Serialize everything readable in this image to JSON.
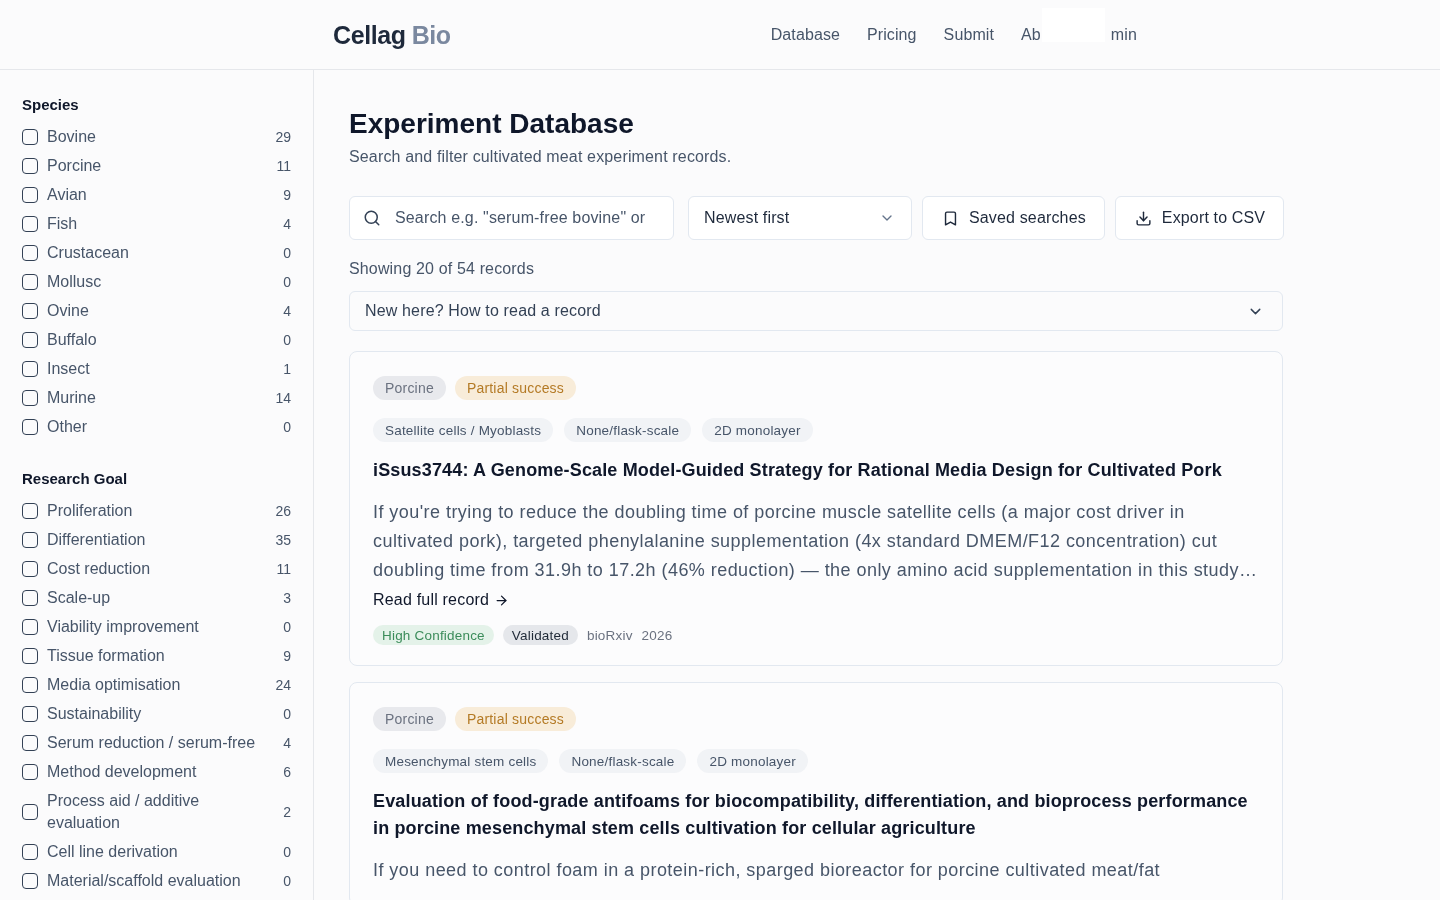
{
  "header": {
    "logo": {
      "name": "Cellag",
      "suffix": "Bio"
    },
    "nav": [
      {
        "label": "Database"
      },
      {
        "label": "Pricing"
      },
      {
        "label": "Submit"
      },
      {
        "label": "Ab"
      },
      {
        "label": "min"
      }
    ]
  },
  "sidebar": {
    "groups": [
      {
        "title": "Species",
        "options": [
          {
            "label": "Bovine",
            "count": "29",
            "checked": false
          },
          {
            "label": "Porcine",
            "count": "11",
            "checked": false
          },
          {
            "label": "Avian",
            "count": "9",
            "checked": false
          },
          {
            "label": "Fish",
            "count": "4",
            "checked": false
          },
          {
            "label": "Crustacean",
            "count": "0",
            "checked": false
          },
          {
            "label": "Mollusc",
            "count": "0",
            "checked": false
          },
          {
            "label": "Ovine",
            "count": "4",
            "checked": false
          },
          {
            "label": "Buffalo",
            "count": "0",
            "checked": false
          },
          {
            "label": "Insect",
            "count": "1",
            "checked": false
          },
          {
            "label": "Murine",
            "count": "14",
            "checked": false
          },
          {
            "label": "Other",
            "count": "0",
            "checked": false
          }
        ]
      },
      {
        "title": "Research Goal",
        "options": [
          {
            "label": "Proliferation",
            "count": "26",
            "checked": false
          },
          {
            "label": "Differentiation",
            "count": "35",
            "checked": false
          },
          {
            "label": "Cost reduction",
            "count": "11",
            "checked": false
          },
          {
            "label": "Scale-up",
            "count": "3",
            "checked": false
          },
          {
            "label": "Viability improvement",
            "count": "0",
            "checked": false
          },
          {
            "label": "Tissue formation",
            "count": "9",
            "checked": false
          },
          {
            "label": "Media optimisation",
            "count": "24",
            "checked": false
          },
          {
            "label": "Sustainability",
            "count": "0",
            "checked": false
          },
          {
            "label": "Serum reduction / serum-free",
            "count": "4",
            "checked": false
          },
          {
            "label": "Method development",
            "count": "6",
            "checked": false
          },
          {
            "label": "Process aid / additive evaluation",
            "count": "2",
            "checked": false
          },
          {
            "label": "Cell line derivation",
            "count": "0",
            "checked": false
          },
          {
            "label": "Material/scaffold evaluation",
            "count": "0",
            "checked": false
          }
        ]
      }
    ]
  },
  "main": {
    "title": "Experiment Database",
    "subtitle": "Search and filter cultivated meat experiment records.",
    "search": {
      "placeholder": "Search e.g. \"serum-free bovine\" or"
    },
    "sort": {
      "value": "Newest first"
    },
    "actions": [
      {
        "label": "Saved searches",
        "kind": "saved"
      },
      {
        "label": "Export to CSV",
        "kind": "export"
      }
    ],
    "result_count": "Showing 20 of 54 records",
    "guide": {
      "label": "New here? How to read a record",
      "expanded": false
    },
    "records": [
      {
        "species": "Porcine",
        "outcome": {
          "label": "Partial success",
          "kind": "partial"
        },
        "tags": [
          "Satellite cells / Myoblasts",
          "None/flask-scale",
          "2D monolayer"
        ],
        "title": "iSsus3744: A Genome-Scale Model-Guided Strategy for Rational Media Design for Cultivated Pork",
        "summary": "If you're trying to reduce the doubling time of porcine muscle satellite cells (a major cost driver in cultivated pork), targeted phenylalanine supplementation (4x standard DMEM/F12 concentration) cut doubling time from 31.9h to 17.2h (46% reduction) — the only amino acid supplementation in this study…",
        "link": "Read full record",
        "badges": [
          {
            "label": "High Confidence",
            "kind": "confidence"
          },
          {
            "label": "Validated",
            "kind": "status"
          }
        ],
        "source": "bioRxiv",
        "year": "2026"
      },
      {
        "species": "Porcine",
        "outcome": {
          "label": "Partial success",
          "kind": "partial"
        },
        "tags": [
          "Mesenchymal stem cells",
          "None/flask-scale",
          "2D monolayer"
        ],
        "title": "Evaluation of food-grade antifoams for biocompatibility, differentiation, and bioprocess performance in porcine mesenchymal stem cells cultivation for cellular agriculture",
        "summary": "If you need to control foam in a protein-rich, sparged bioreactor for porcine cultivated meat/fat"
      }
    ]
  }
}
